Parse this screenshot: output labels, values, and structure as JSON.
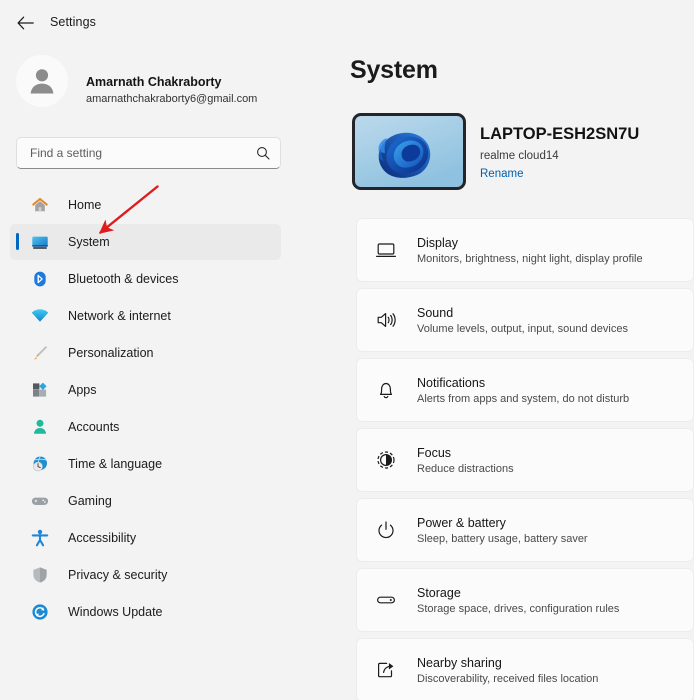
{
  "titlebar": {
    "back_label": "back-arrow",
    "title": "Settings"
  },
  "sidebar": {
    "account": {
      "name": "Amarnath Chakraborty",
      "email": "amarnathchakraborty6@gmail.com",
      "avatar_icon": "person-avatar-icon"
    },
    "search": {
      "placeholder": "Find a setting",
      "value": "",
      "icon": "search-icon"
    },
    "items": [
      {
        "label": "Home",
        "icon": "home-icon",
        "selected": false
      },
      {
        "label": "System",
        "icon": "monitor-icon",
        "selected": true
      },
      {
        "label": "Bluetooth & devices",
        "icon": "bluetooth-icon",
        "selected": false
      },
      {
        "label": "Network & internet",
        "icon": "wifi-icon",
        "selected": false
      },
      {
        "label": "Personalization",
        "icon": "paintbrush-icon",
        "selected": false
      },
      {
        "label": "Apps",
        "icon": "apps-icon",
        "selected": false
      },
      {
        "label": "Accounts",
        "icon": "person-icon",
        "selected": false
      },
      {
        "label": "Time & language",
        "icon": "clock-globe-icon",
        "selected": false
      },
      {
        "label": "Gaming",
        "icon": "gamepad-icon",
        "selected": false
      },
      {
        "label": "Accessibility",
        "icon": "accessibility-icon",
        "selected": false
      },
      {
        "label": "Privacy & security",
        "icon": "shield-icon",
        "selected": false
      },
      {
        "label": "Windows Update",
        "icon": "update-icon",
        "selected": false
      }
    ]
  },
  "main": {
    "page_title": "System",
    "device": {
      "name": "LAPTOP-ESH2SN7U",
      "model": "realme cloud14",
      "rename_label": "Rename",
      "thumbnail_icon": "windows-bloom-wallpaper"
    },
    "cards": [
      {
        "title": "Display",
        "subtitle": "Monitors, brightness, night light, display profile",
        "icon": "display-icon"
      },
      {
        "title": "Sound",
        "subtitle": "Volume levels, output, input, sound devices",
        "icon": "speaker-icon"
      },
      {
        "title": "Notifications",
        "subtitle": "Alerts from apps and system, do not disturb",
        "icon": "bell-icon"
      },
      {
        "title": "Focus",
        "subtitle": "Reduce distractions",
        "icon": "focus-icon"
      },
      {
        "title": "Power & battery",
        "subtitle": "Sleep, battery usage, battery saver",
        "icon": "power-icon"
      },
      {
        "title": "Storage",
        "subtitle": "Storage space, drives, configuration rules",
        "icon": "storage-icon"
      },
      {
        "title": "Nearby sharing",
        "subtitle": "Discoverability, received files location",
        "icon": "share-icon"
      }
    ]
  },
  "annotation": {
    "arrow_color": "#e01b1b",
    "points_to": "System"
  },
  "colors": {
    "page_background": "#f3f3f3",
    "card_background": "#fbfbfb",
    "accent": "#0067c0",
    "link": "#0060ae",
    "selected_row": "#eaeaea"
  }
}
